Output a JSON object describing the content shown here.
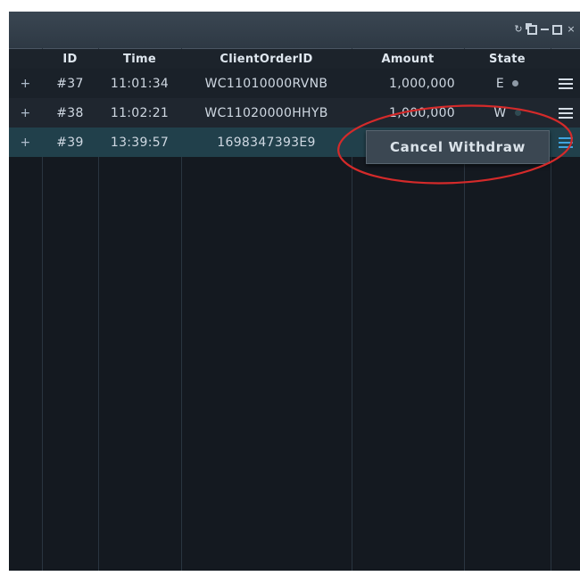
{
  "window": {
    "controls": [
      {
        "name": "refresh-icon",
        "glyph": "↻"
      },
      {
        "name": "popout-icon",
        "glyph": ""
      },
      {
        "name": "minimize-icon",
        "glyph": ""
      },
      {
        "name": "maximize-icon",
        "glyph": ""
      },
      {
        "name": "close-icon",
        "glyph": "×"
      }
    ]
  },
  "table": {
    "headers": {
      "id": "ID",
      "time": "Time",
      "client_order_id": "ClientOrderID",
      "amount": "Amount",
      "state": "State"
    },
    "rows": [
      {
        "expand": "+",
        "id": "#37",
        "time": "11:01:34",
        "client_order_id": "WC11010000RVNB",
        "amount": "1,000,000",
        "state": "E"
      },
      {
        "expand": "+",
        "id": "#38",
        "time": "11:02:21",
        "client_order_id": "WC11020000HHYB",
        "amount": "1,000,000",
        "state": "W"
      },
      {
        "expand": "+",
        "id": "#39",
        "time": "13:39:57",
        "client_order_id": "1698347393E9",
        "amount": "",
        "state": ""
      }
    ]
  },
  "context_menu": {
    "cancel_withdraw_label": "Cancel Withdraw"
  },
  "colors": {
    "selected_row": "#21404b",
    "annotation_circle": "#d42a2a",
    "active_menu_icon": "#3fa4df"
  }
}
